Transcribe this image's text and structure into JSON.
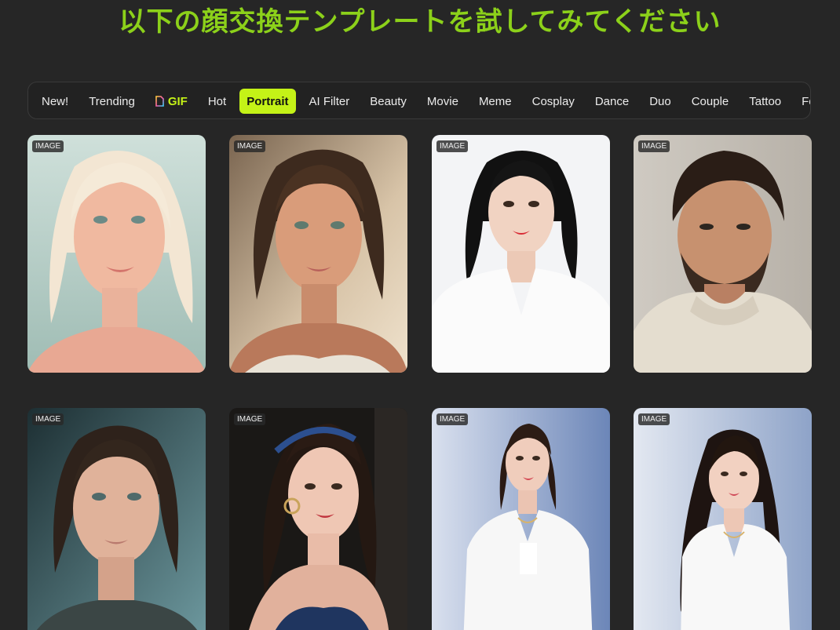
{
  "headline": "以下の顔交換テンプレートを試してみてください",
  "tabs": [
    {
      "label": "New!",
      "active": false
    },
    {
      "label": "Trending",
      "active": false
    },
    {
      "label": "GIF",
      "active": false,
      "icon": "gif-file-icon"
    },
    {
      "label": "Hot",
      "active": false
    },
    {
      "label": "Portrait",
      "active": true
    },
    {
      "label": "AI Filter",
      "active": false
    },
    {
      "label": "Beauty",
      "active": false
    },
    {
      "label": "Movie",
      "active": false
    },
    {
      "label": "Meme",
      "active": false
    },
    {
      "label": "Cosplay",
      "active": false
    },
    {
      "label": "Dance",
      "active": false
    },
    {
      "label": "Duo",
      "active": false
    },
    {
      "label": "Couple",
      "active": false
    },
    {
      "label": "Tattoo",
      "active": false
    },
    {
      "label": "Fe",
      "active": false
    }
  ],
  "cards": [
    {
      "badge": "IMAGE",
      "subject": "woman with platinum blonde bob"
    },
    {
      "badge": "IMAGE",
      "subject": "woman with messy brown updo"
    },
    {
      "badge": "IMAGE",
      "subject": "woman with black hair in white sweater"
    },
    {
      "badge": "IMAGE",
      "subject": "bearded man in knit sweater"
    },
    {
      "badge": "IMAGE",
      "subject": "woman with brown hair, freckles"
    },
    {
      "badge": "IMAGE",
      "subject": "woman with headband and hoop earrings"
    },
    {
      "badge": "IMAGE",
      "subject": "woman in white blazer"
    },
    {
      "badge": "IMAGE",
      "subject": "woman in white blazer, side pose"
    }
  ],
  "colors": {
    "background": "#262626",
    "accent": "#c4f217",
    "headline": "#8cd11a"
  }
}
